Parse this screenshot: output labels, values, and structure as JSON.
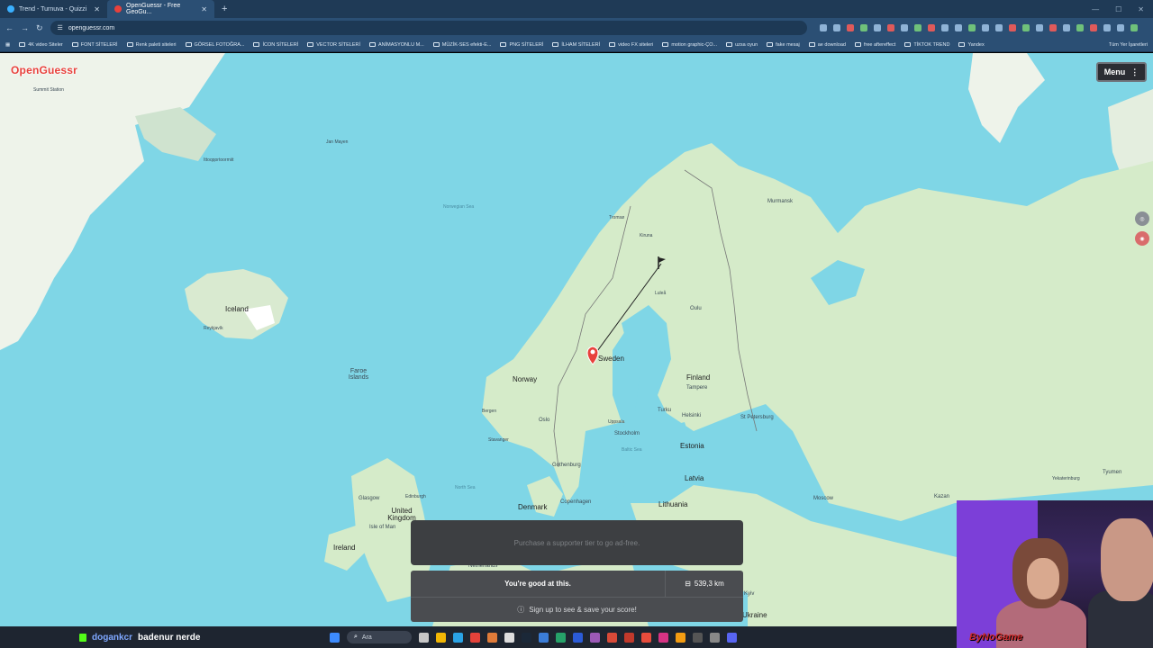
{
  "browser": {
    "tabs": [
      {
        "title": "Trend - Turnuva - Quizzi",
        "active": false
      },
      {
        "title": "OpenGuessr - Free GeoGu...",
        "active": true
      }
    ],
    "url": "openguessr.com",
    "bookmarks": [
      "4K video Siteler",
      "FONT SİTELERİ",
      "Renk paleti siteleri",
      "GÖRSEL FOTOĞRA...",
      "İCON SİTELERİ",
      "VECTOR SİTELERİ",
      "ANİMASYONLU M...",
      "MÜZİK-SES efekti-E...",
      "PNG SİTELERİ",
      "İLHAM SİTELERİ",
      "video FX siteleri",
      "motion graphic-ÇO...",
      "uzsa oyun",
      "fake mesaj",
      "ae download",
      "free aftereffect",
      "TİKTOK TREND",
      "Yandex"
    ],
    "bookmarks_more": "Tüm Yer İşaretleri"
  },
  "app": {
    "logo": "OpenGuessr",
    "menu_label": "Menu",
    "ad_text": "Purchase a supporter tier to go ad-free.",
    "result_text": "You're good at this.",
    "distance": "539,3 km",
    "signup_text": "Sign up to see & save your score!",
    "accent": "#e8413c"
  },
  "map": {
    "labels": [
      "Summit Station",
      "Jan Mayen",
      "Ittoqqortoormiit",
      "Norwegian Sea",
      "Iceland",
      "Reykjavík",
      "Faroe Islands",
      "Norway",
      "Sweden",
      "Finland",
      "Bergen",
      "Oslo",
      "Stavanger",
      "Gothenburg",
      "Denmark",
      "Copenhagen",
      "Tampere",
      "Turku",
      "Helsinki",
      "Estonia",
      "Latvia",
      "Lithuania",
      "St Petersburg",
      "Murmansk",
      "Oulu",
      "Luleå",
      "Tromsø",
      "Kiruna",
      "Stockholm",
      "Uppsala",
      "Glasgow",
      "United Kingdom",
      "Isle of Man",
      "Ireland",
      "Netherlands",
      "North Sea",
      "Baltic Sea",
      "Moscow",
      "Kazan",
      "Tyumen",
      "Yekaterinburg",
      "Kyiv",
      "Ukraine",
      "Edinburgh"
    ],
    "marker_label": "Sweden"
  },
  "stream": {
    "chat_user": "dogankcr",
    "chat_message": "badenur nerde",
    "watermark": "ByNoGame",
    "taskbar_search": "Ara"
  }
}
